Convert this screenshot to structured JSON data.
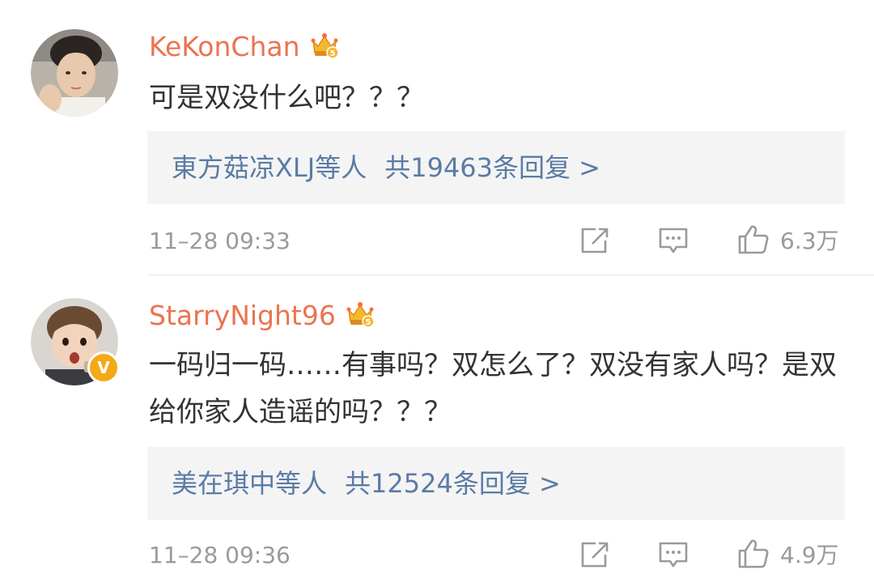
{
  "comments": [
    {
      "username": "KeKonChan",
      "text": "可是双没什么吧？？？",
      "replies": {
        "names": "東方菇凉XLJ等人",
        "summary": "共19463条回复 >"
      },
      "time": "11–28 09:33",
      "likes": "6.3万",
      "verified": false,
      "membership_badge": "crown-5-icon"
    },
    {
      "username": "StarryNight96",
      "text": "一码归一码……有事吗？双怎么了？双没有家人吗？是双给你家人造谣的吗？？？",
      "replies": {
        "names": "美在琪中等人",
        "summary": "共12524条回复 >"
      },
      "time": "11–28 09:36",
      "likes": "4.9万",
      "verified": true,
      "verified_label": "V",
      "membership_badge": "crown-5-icon"
    }
  ],
  "colors": {
    "username": "#eb7350",
    "reply_link": "#5a7ba5",
    "meta_text": "#9a9a9a",
    "reply_box_bg": "#f4f4f4",
    "verified_badge": "#f4a915"
  }
}
